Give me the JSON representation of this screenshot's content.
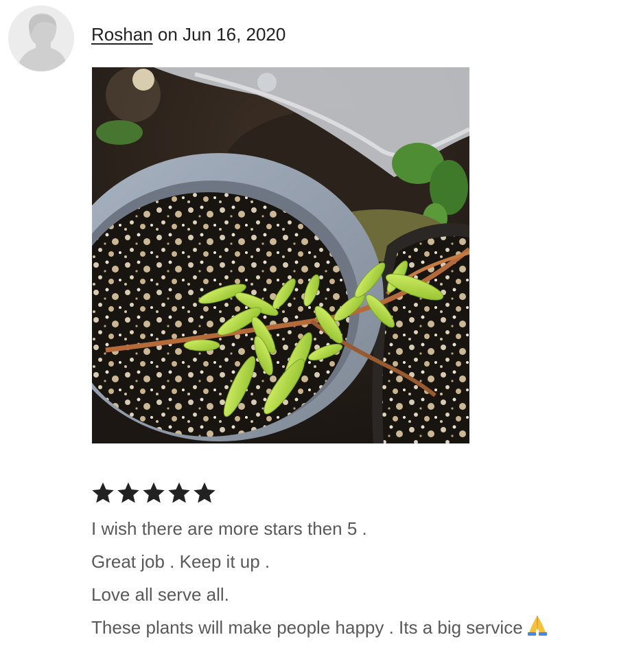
{
  "review": {
    "reviewer_name": "Roshan",
    "date_text": "on Jun 16, 2020",
    "avatar_icon": "default-user-avatar-icon",
    "photo_alt": "Review photo",
    "rating": 5,
    "rating_max": 5,
    "text_lines": [
      "I wish there are more stars then 5 .",
      "Great job . Keep it up .",
      "Love all serve all.",
      "These plants will make people happy . Its a big service"
    ],
    "trailing_emoji_icon": "folded-hands-emoji-icon"
  },
  "colors": {
    "text_primary": "#222222",
    "text_secondary": "#595959",
    "star": "#222222",
    "avatar_bg": "#ececec"
  }
}
